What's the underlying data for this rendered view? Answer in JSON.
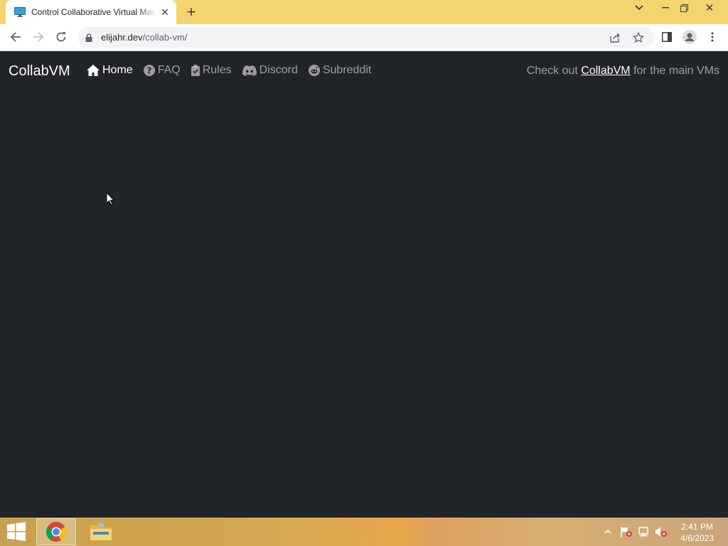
{
  "browser": {
    "tab_title": "Control Collaborative Virtual Machines",
    "url_domain": "elijahr.dev",
    "url_path": "/collab-vm/",
    "accent_color": "#f3d46e"
  },
  "page": {
    "brand": "CollabVM",
    "nav": [
      {
        "label": "Home",
        "icon": "home-icon",
        "active": true
      },
      {
        "label": "FAQ",
        "icon": "question-circle-icon",
        "active": false
      },
      {
        "label": "Rules",
        "icon": "clipboard-check-icon",
        "active": false
      },
      {
        "label": "Discord",
        "icon": "discord-icon",
        "active": false
      },
      {
        "label": "Subreddit",
        "icon": "reddit-icon",
        "active": false
      }
    ],
    "right_prefix": "Check out ",
    "right_link": "CollabVM",
    "right_suffix": " for the main VMs",
    "background_color": "#212529"
  },
  "taskbar": {
    "time": "2:41 PM",
    "date": "4/6/2023"
  }
}
